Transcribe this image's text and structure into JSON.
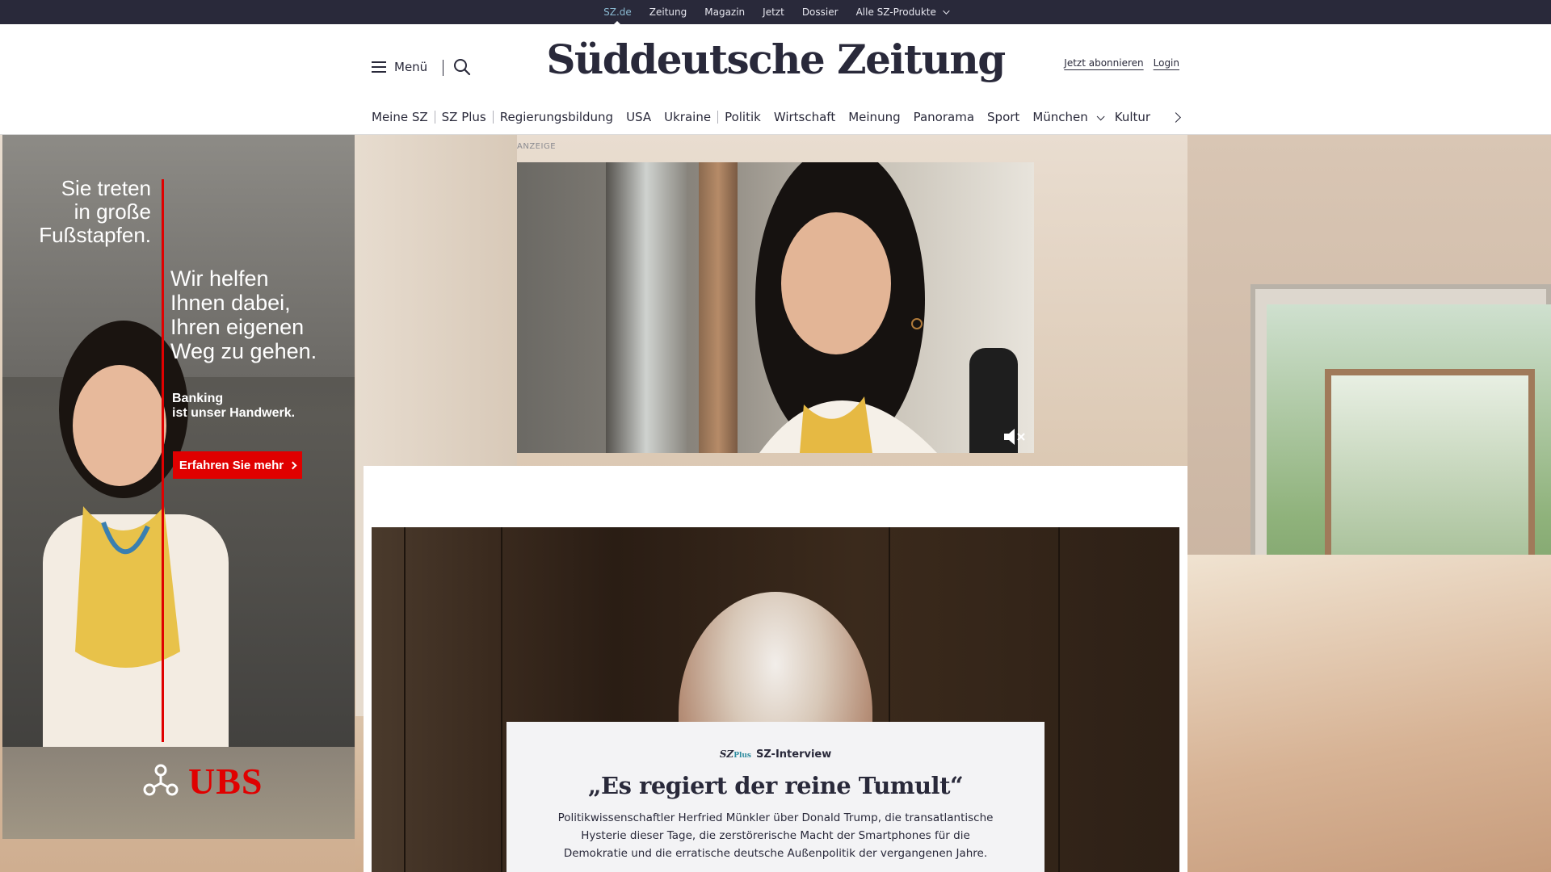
{
  "topbar": {
    "items": [
      "SZ.de",
      "Zeitung",
      "Magazin",
      "Jetzt",
      "Dossier",
      "Alle SZ-Produkte"
    ]
  },
  "header": {
    "menu_label": "Menü",
    "logo": "Süddeutsche Zeitung",
    "subscribe_label": "Jetzt abonnieren",
    "login_label": "Login"
  },
  "nav": {
    "items": [
      "Meine SZ",
      "SZ Plus",
      "Regierungsbildung",
      "USA",
      "Ukraine",
      "Politik",
      "Wirtschaft",
      "Meinung",
      "Panorama",
      "Sport",
      "München",
      "Kultur"
    ]
  },
  "ad_left": {
    "headline": "Sie treten\nin große\nFußstapfen.",
    "subline": "Wir helfen\nIhnen dabei,\nIhren eigenen\nWeg zu gehen.",
    "tagline": "Banking\nist unser Handwerk.",
    "cta": "Erfahren Sie mehr",
    "brand": "UBS",
    "brand_color": "#e00000"
  },
  "video_ad": {
    "label": "ANZEIGE"
  },
  "article": {
    "brand": "SZ",
    "brand_suffix": "Plus",
    "kicker": "SZ-Interview",
    "title": "„Es regiert der reine Tumult“",
    "teaser": "Politikwissenschaftler Herfried Münkler über Donald Trump, die transatlantische Hysterie dieser Tage, die zerstörerische Macht der Smartphones für die Demokratie und die erratische deutsche Außenpolitik der vergangenen Jahre."
  },
  "colors": {
    "brand_dark": "#29293a",
    "accent_teal": "#2c8a9e",
    "ad_red": "#e00000"
  }
}
